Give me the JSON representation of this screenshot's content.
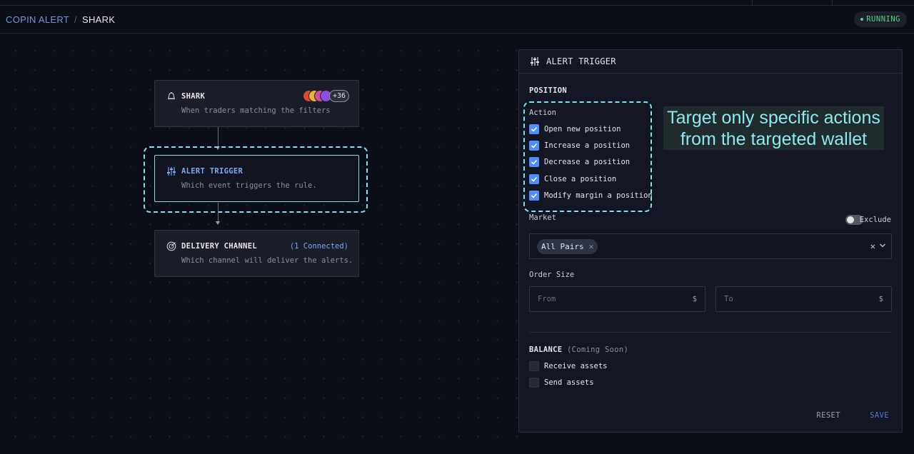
{
  "breadcrumb": {
    "root": "COPIN ALERT",
    "separator": "/",
    "current": "SHARK"
  },
  "status": {
    "label": "RUNNING",
    "color": "#52d18b"
  },
  "flow": {
    "source": {
      "title": "SHARK",
      "description": "When traders matching the filters",
      "avatar_more": "+36",
      "icon": "bell-icon"
    },
    "trigger": {
      "title": "ALERT TRIGGER",
      "description": "Which event triggers the rule.",
      "icon": "sliders-icon"
    },
    "delivery": {
      "title": "DELIVERY CHANNEL",
      "description": "Which channel will deliver the alerts.",
      "connected": "(1 Connected)",
      "icon": "target-icon"
    }
  },
  "panel": {
    "title": "ALERT TRIGGER",
    "position": {
      "heading": "POSITION",
      "action_label": "Action",
      "actions": [
        {
          "label": "Open new position",
          "checked": true
        },
        {
          "label": "Increase a position",
          "checked": true
        },
        {
          "label": "Decrease a position",
          "checked": true
        },
        {
          "label": "Close a position",
          "checked": true
        },
        {
          "label": "Modify margin a position",
          "checked": true
        }
      ],
      "market_label": "Market",
      "exclude_label": "Exclude",
      "exclude_on": false,
      "market_chip": "All Pairs",
      "order_size_label": "Order Size",
      "from_placeholder": "From",
      "to_placeholder": "To",
      "currency": "$"
    },
    "balance": {
      "heading": "BALANCE",
      "note": "(Coming Soon)",
      "options": [
        {
          "label": "Receive assets",
          "checked": false
        },
        {
          "label": "Send assets",
          "checked": false
        }
      ]
    },
    "reset_label": "RESET",
    "save_label": "SAVE"
  },
  "annotation": {
    "text_line1": "Target only specific actions",
    "text_line2": "from the targeted wallet"
  },
  "colors": {
    "accent": "#4f8ff7",
    "highlight": "#7fe3ef",
    "background": "#0c0e17"
  }
}
